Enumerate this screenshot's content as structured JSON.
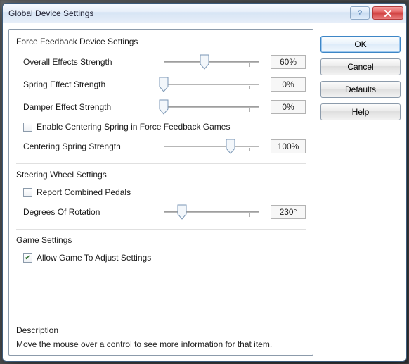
{
  "window": {
    "title": "Global Device Settings"
  },
  "buttons": {
    "ok": "OK",
    "cancel": "Cancel",
    "defaults": "Defaults",
    "help": "Help"
  },
  "sections": {
    "ffb": {
      "title": "Force Feedback Device Settings",
      "overall": {
        "label": "Overall Effects Strength",
        "value": "60%",
        "pos": 40
      },
      "spring": {
        "label": "Spring Effect Strength",
        "value": "0%",
        "pos": 0
      },
      "damper": {
        "label": "Damper Effect Strength",
        "value": "0%",
        "pos": 0
      },
      "enableCentering": {
        "label": "Enable Centering Spring in Force Feedback Games",
        "checked": false
      },
      "centering": {
        "label": "Centering Spring Strength",
        "value": "100%",
        "pos": 66
      }
    },
    "steering": {
      "title": "Steering Wheel Settings",
      "combined": {
        "label": "Report Combined Pedals",
        "checked": false
      },
      "rotation": {
        "label": "Degrees Of Rotation",
        "value": "230°",
        "pos": 18
      }
    },
    "game": {
      "title": "Game Settings",
      "allowAdjust": {
        "label": "Allow Game To Adjust Settings",
        "checked": true
      }
    },
    "desc": {
      "title": "Description",
      "text": "Move the mouse over a control to see more information for that item."
    }
  }
}
